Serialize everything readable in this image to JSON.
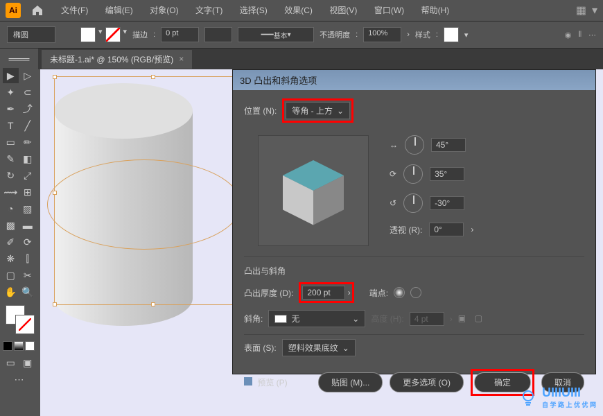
{
  "app": {
    "logo": "Ai"
  },
  "menus": [
    "文件(F)",
    "编辑(E)",
    "对象(O)",
    "文字(T)",
    "选择(S)",
    "效果(C)",
    "视图(V)",
    "窗口(W)",
    "帮助(H)"
  ],
  "controlBar": {
    "shape": "椭圆",
    "strokeLabel": "描边",
    "strokeWeight": "0 pt",
    "strokeStyle": "基本",
    "opacityLabel": "不透明度",
    "opacityValue": "100%",
    "styleLabel": "样式"
  },
  "document": {
    "tab": "未标题-1.ai* @ 150% (RGB/预览)"
  },
  "dialog": {
    "title": "3D 凸出和斜角选项",
    "positionLabel": "位置 (N)",
    "positionValue": "等角 - 上方",
    "angleX": "45°",
    "angleY": "35°",
    "angleZ": "-30°",
    "perspectiveLabel": "透视 (R)",
    "perspectiveValue": "0°",
    "extrudeBevelSection": "凸出与斜角",
    "extrudeDepthLabel": "凸出厚度 (D)",
    "extrudeDepthValue": "200 pt",
    "capLabel": "端点",
    "bevelLabel": "斜角",
    "bevelValue": "无",
    "heightLabel": "高度 (H)",
    "heightValue": "4 pt",
    "surfaceLabel": "表面 (S)",
    "surfaceValue": "塑料效果底纹",
    "previewLabel": "预览 (P)",
    "mapArtBtn": "贴图 (M)...",
    "moreOptionsBtn": "更多选项 (O)",
    "okBtn": "确定",
    "cancelBtn": "取消"
  },
  "watermark": {
    "brand": "UIIIUIII",
    "sub": "自 学 路 上 优 优 网"
  }
}
